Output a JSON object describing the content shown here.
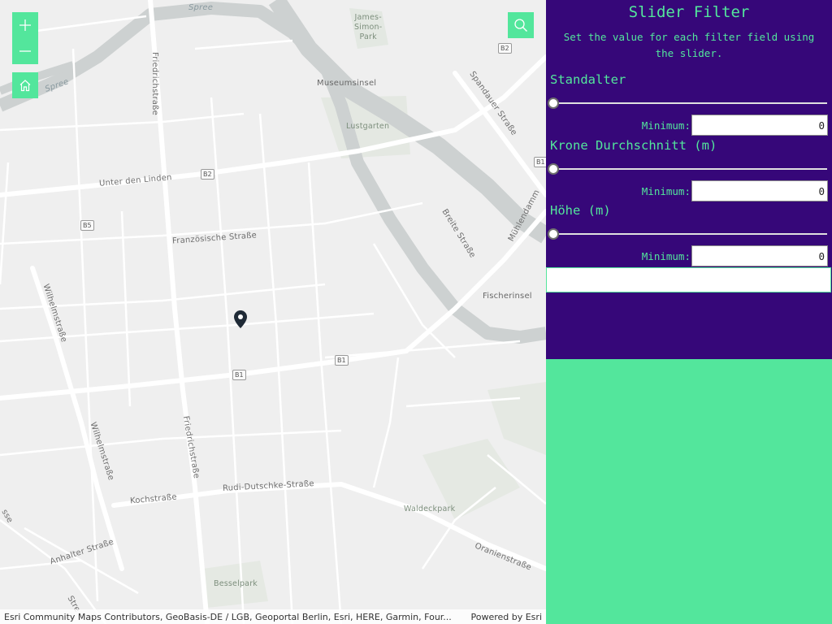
{
  "map": {
    "labels": {
      "spree_1": "Spree",
      "spree_2": "Spree",
      "james_simon_park": "James-\nSimon-\nPark",
      "friedrichstrasse_n": "Friedrichstraße",
      "museumsinsel": "Museumsinsel",
      "lustgarten": "Lustgarten",
      "spandauer_strasse": "Spandauer Straße",
      "unter_den_linden": "Unter den Linden",
      "franzoesische_strasse": "Französische Straße",
      "breite_strasse": "Breite Straße",
      "muehlendamm": "Mühlendamm",
      "fischerinsel": "Fischerinsel",
      "wilhelmstrasse_n": "Wilhelmstraße",
      "wilhelmstrasse_s": "Wilhelmstraße",
      "friedrichstrasse_s": "Friedrichstraße",
      "kochstrasse": "Kochstraße",
      "rudi_dutschke": "Rudi-Dutschke-Straße",
      "waldeckpark": "Waldeckpark",
      "oranienstrasse": "Oranienstraße",
      "anhalter_strasse": "Anhalter Straße",
      "besselpark": "Besselpark",
      "str_edge": "Stre",
      "sse_edge": "sse"
    },
    "shields": {
      "b2_top": "B2",
      "b2_mid": "B2",
      "b1_edge": "B1",
      "b5": "B5",
      "b1_center": "B1",
      "b1_lower": "B1"
    },
    "controls": {
      "zoom_in": "zoom-in-icon",
      "zoom_out": "zoom-out-icon",
      "home": "home-icon",
      "search": "search-icon"
    },
    "attribution": "Esri Community Maps Contributors, GeoBasis-DE / LGB, Geoportal Berlin, Esri, HERE, Garmin, Four...",
    "powered_by": "Powered by Esri"
  },
  "panel": {
    "title": "Slider Filter",
    "description": "Set the value for each filter field using the slider.",
    "fields": [
      {
        "label": "Standalter",
        "min_label": "Minimum:",
        "min_value": "0",
        "slider_fraction": 0
      },
      {
        "label": "Krone Durchschnitt (m)",
        "min_label": "Minimum:",
        "min_value": "0",
        "slider_fraction": 0
      },
      {
        "label": "Höhe (m)",
        "min_label": "Minimum:",
        "min_value": "0",
        "slider_fraction": 0
      }
    ]
  },
  "colors": {
    "accent": "#53e69c",
    "panel_background": "#360779",
    "pin": "#1f2a36"
  }
}
